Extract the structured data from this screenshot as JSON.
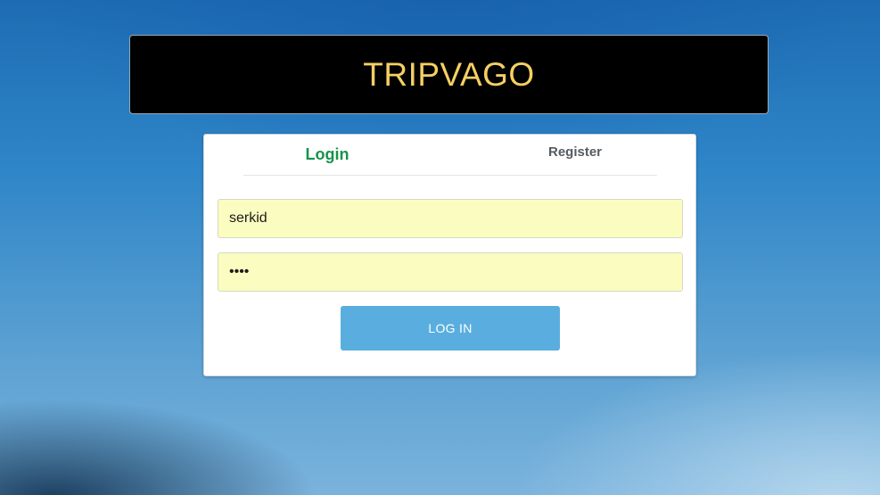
{
  "header": {
    "title": "TRIPVAGO"
  },
  "auth": {
    "tabs": {
      "login": "Login",
      "register": "Register"
    },
    "fields": {
      "username_value": "serkid",
      "password_value": "••••"
    },
    "submit_label": "LOG IN"
  },
  "colors": {
    "brand_title": "#f5cf63",
    "active_tab": "#17934c",
    "button": "#5aaedf",
    "input_fill": "#fbfdc0"
  }
}
